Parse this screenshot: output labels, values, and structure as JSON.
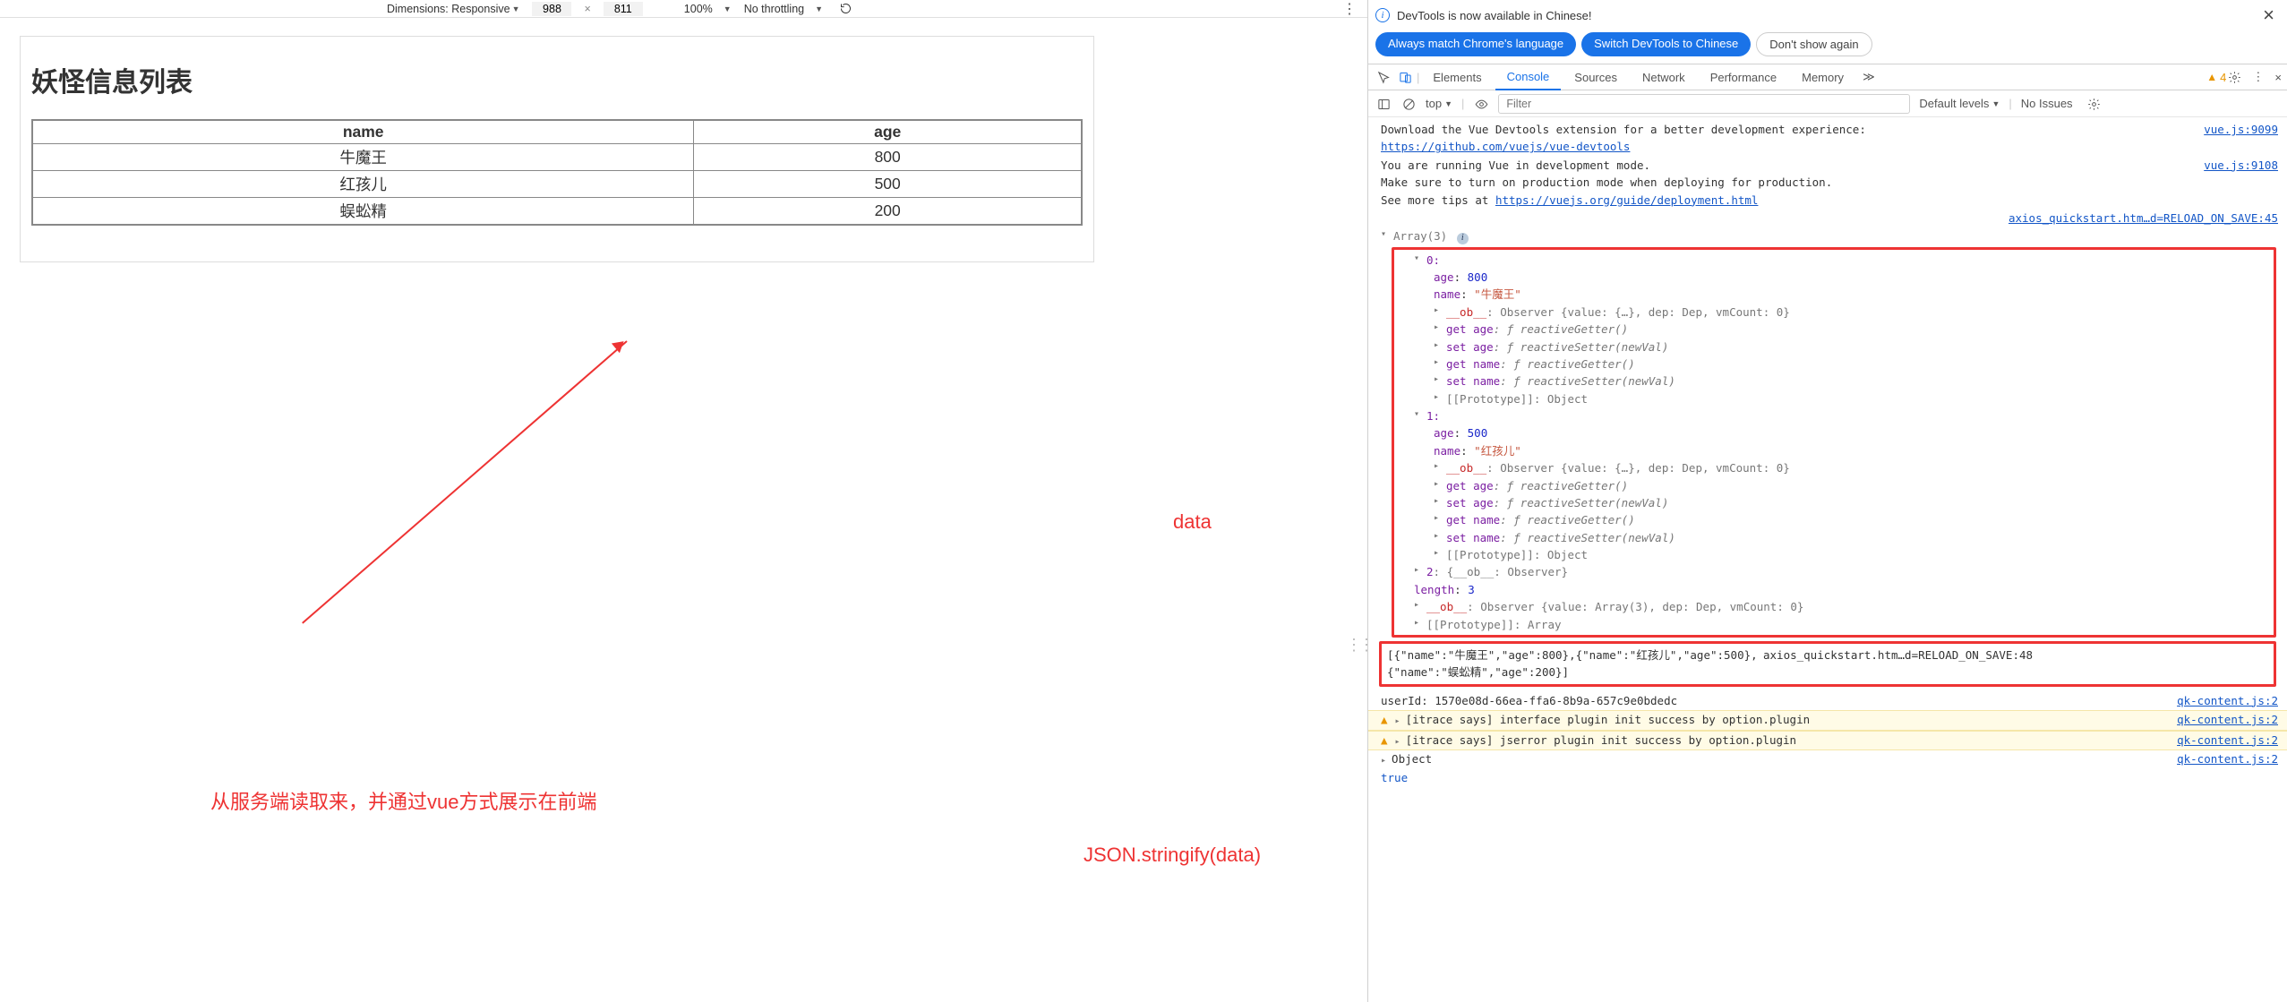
{
  "devicebar": {
    "dimensions_label": "Dimensions: Responsive",
    "width": "988",
    "height": "811",
    "x": "×",
    "zoom": "100%",
    "throttling": "No throttling",
    "kebab": "⋮"
  },
  "page": {
    "title": "妖怪信息列表",
    "table": {
      "headers": [
        "name",
        "age"
      ],
      "rows": [
        {
          "name": "牛魔王",
          "age": "800"
        },
        {
          "name": "红孩儿",
          "age": "500"
        },
        {
          "name": "蜈蚣精",
          "age": "200"
        }
      ]
    }
  },
  "annotations": {
    "label1": "从服务端读取来，并通过vue方式展示在前端",
    "label2": "data",
    "label3": "JSON.stringify(data)"
  },
  "infobar": {
    "text": "DevTools is now available in Chinese!"
  },
  "chips": {
    "match": "Always match Chrome's language",
    "switch": "Switch DevTools to Chinese",
    "dontshow": "Don't show again"
  },
  "tabs": {
    "elements": "Elements",
    "console": "Console",
    "sources": "Sources",
    "network": "Network",
    "performance": "Performance",
    "memory": "Memory",
    "more": "≫",
    "warn_count": "4"
  },
  "console_toolbar": {
    "context": "top",
    "filter_placeholder": "Filter",
    "levels": "Default levels",
    "issues": "No Issues"
  },
  "console": {
    "vue_devtools1": "Download the Vue Devtools extension for a better development experience:",
    "vue_devtools_url": "https://github.com/vuejs/vue-devtools",
    "vue_src1": "vue.js:9099",
    "vue_dev1": "You are running Vue in development mode.",
    "vue_dev2": "Make sure to turn on production mode when deploying for production.",
    "vue_dev3_pre": "See more tips at ",
    "vue_dev3_url": "https://vuejs.org/guide/deployment.html",
    "vue_src2": "vue.js:9108",
    "axios_src1": "axios_quickstart.htm…d=RELOAD_ON_SAVE:45",
    "array_head": "Array(3)",
    "obj0_idx": "0:",
    "obj0_age_k": "age",
    "obj0_age_c": ": ",
    "obj0_age_v": "800",
    "obj0_name_k": "name",
    "obj0_name_c": ": ",
    "obj0_name_v": "\"牛魔王\"",
    "ob_line": "__ob__: Observer {value: {…}, dep: Dep, vmCount: 0}",
    "get_age": "get age",
    "get_age_f": ": ƒ reactiveGetter()",
    "set_age": "set age",
    "set_age_f": ": ƒ reactiveSetter(newVal)",
    "get_name": "get name",
    "get_name_f": ": ƒ reactiveGetter()",
    "set_name": "set name",
    "set_name_f": ": ƒ reactiveSetter(newVal)",
    "proto": "[[Prototype]]: Object",
    "obj1_idx": "1:",
    "obj1_age_v": "500",
    "obj1_name_v": "\"红孩儿\"",
    "obj2": "2: {__ob__: Observer}",
    "length": "length",
    "length_c": ": ",
    "length_v": "3",
    "ob_arr": "__ob__: Observer {value: Array(3), dep: Dep, vmCount: 0}",
    "proto_arr": "[[Prototype]]: Array",
    "stringify": "[{\"name\":\"牛魔王\",\"age\":800},{\"name\":\"红孩儿\",\"age\":500},{\"name\":\"蜈蚣精\",\"age\":200}]",
    "axios_src2": "axios_quickstart.htm…d=RELOAD_ON_SAVE:48",
    "userid": "userId: 1570e08d-66ea-ffa6-8b9a-657c9e0bdedc",
    "qk_src": "qk-content.js:2",
    "itrace1": "[itrace says] interface plugin init success by option.plugin",
    "itrace2": "[itrace says] jserror plugin init success by option.plugin",
    "obj_line": "Object",
    "true": "true"
  }
}
